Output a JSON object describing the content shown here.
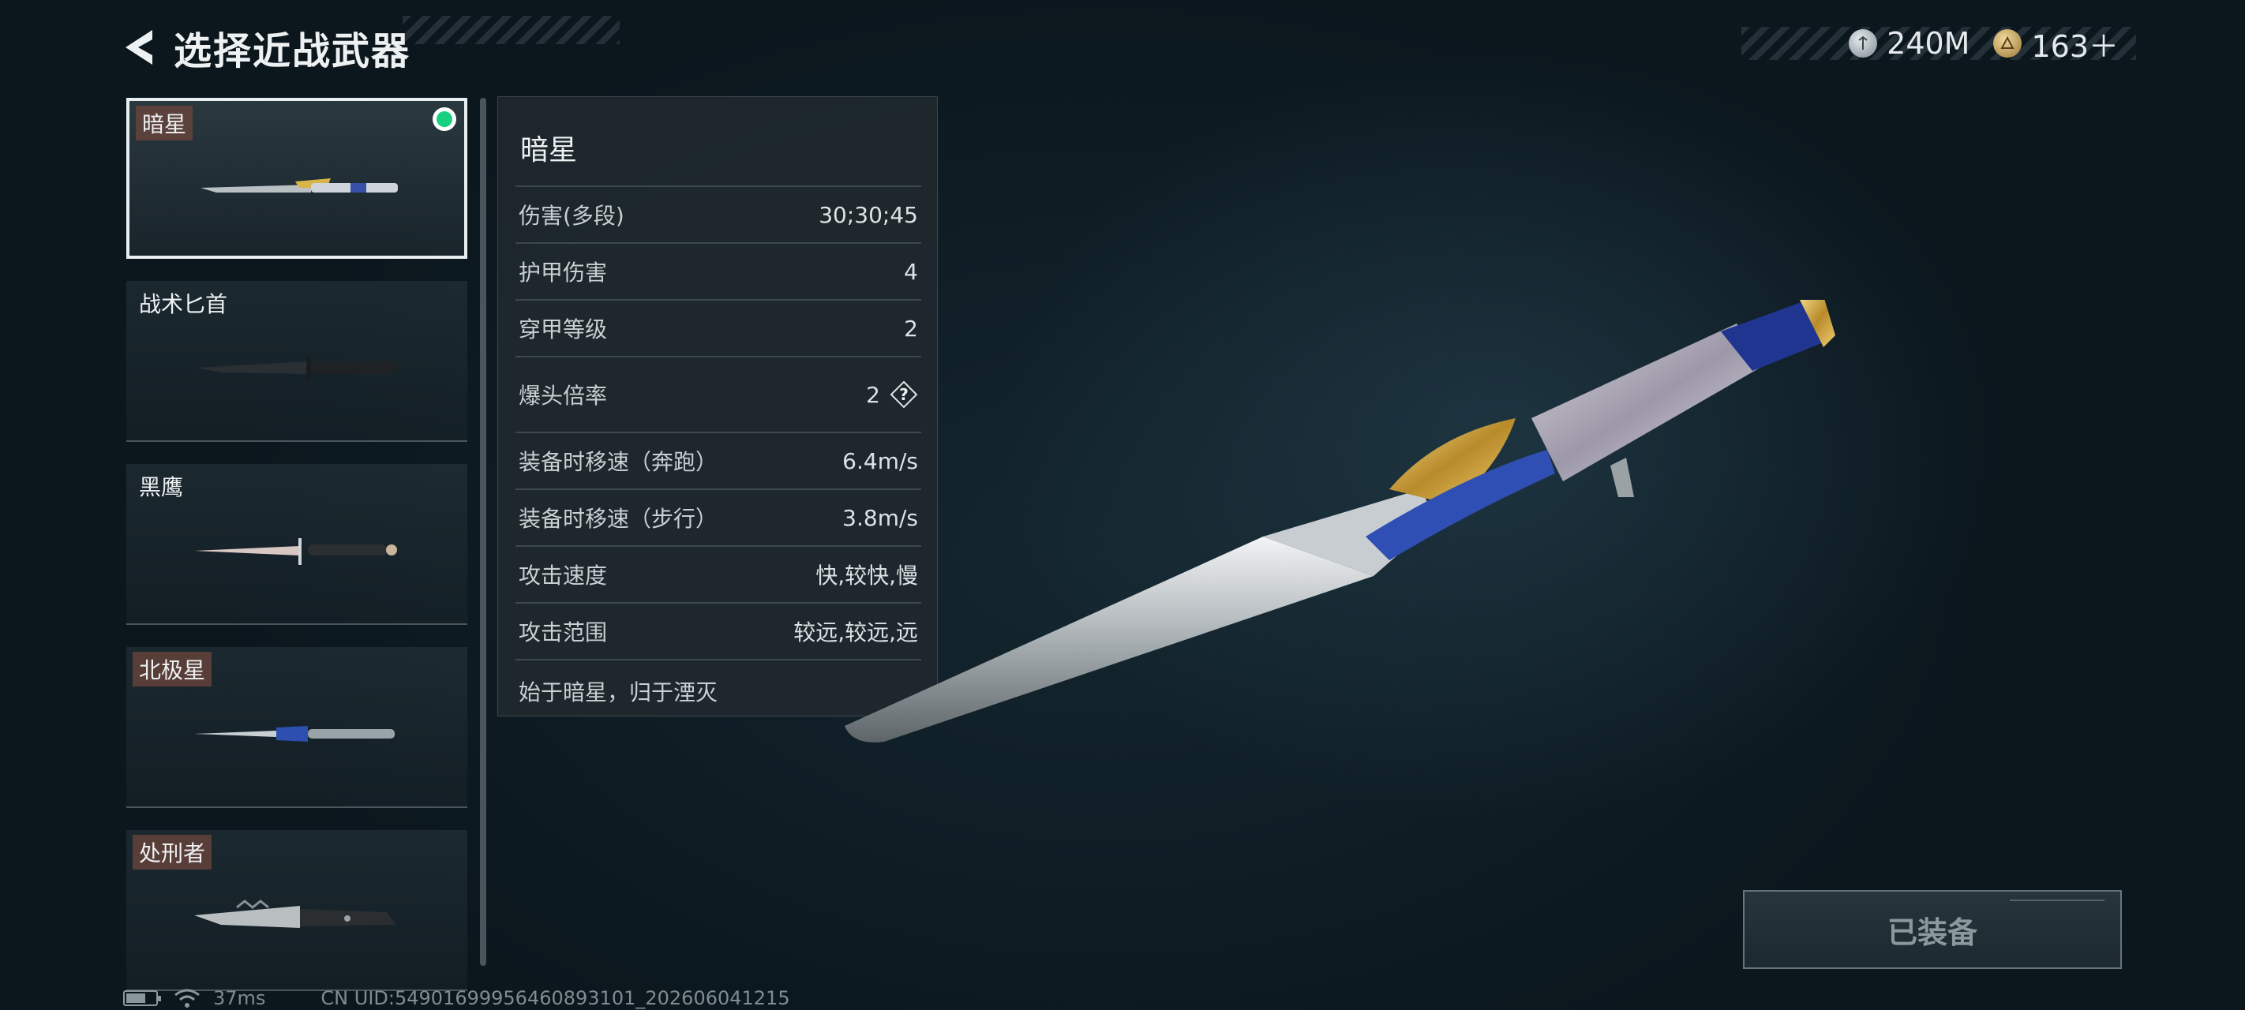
{
  "header": {
    "title": "选择近战武器"
  },
  "currency": [
    {
      "icon": "silver-coin-icon",
      "value": "240M"
    },
    {
      "icon": "gold-coin-icon",
      "value": "163＋"
    }
  ],
  "weapons": [
    {
      "name": "暗星",
      "selected": true,
      "equipped": true
    },
    {
      "name": "战术匕首",
      "selected": false
    },
    {
      "name": "黑鹰",
      "selected": false
    },
    {
      "name": "北极星",
      "selected": false
    },
    {
      "name": "处刑者",
      "selected": false
    }
  ],
  "stats": {
    "title": "暗星",
    "rows": [
      {
        "label": "伤害(多段)",
        "value": "30;30;45"
      },
      {
        "label": "护甲伤害",
        "value": "4"
      },
      {
        "label": "穿甲等级",
        "value": "2"
      },
      {
        "label": "爆头倍率",
        "value": "2",
        "help": "?"
      },
      {
        "label": "装备时移速（奔跑）",
        "value": "6.4m/s"
      },
      {
        "label": "装备时移速（步行）",
        "value": "3.8m/s"
      },
      {
        "label": "攻击速度",
        "value": "快,较快,慢"
      },
      {
        "label": "攻击范围",
        "value": "较远,较远,远"
      }
    ],
    "description": "始于暗星，归于湮灭"
  },
  "equip_button": {
    "label": "已装备"
  },
  "status": {
    "ping": "37ms",
    "uid": "CN UID:5490169995646089310​1_202606041215"
  },
  "colors": {
    "equipped": "#18d080",
    "background": "#0d1a22"
  }
}
